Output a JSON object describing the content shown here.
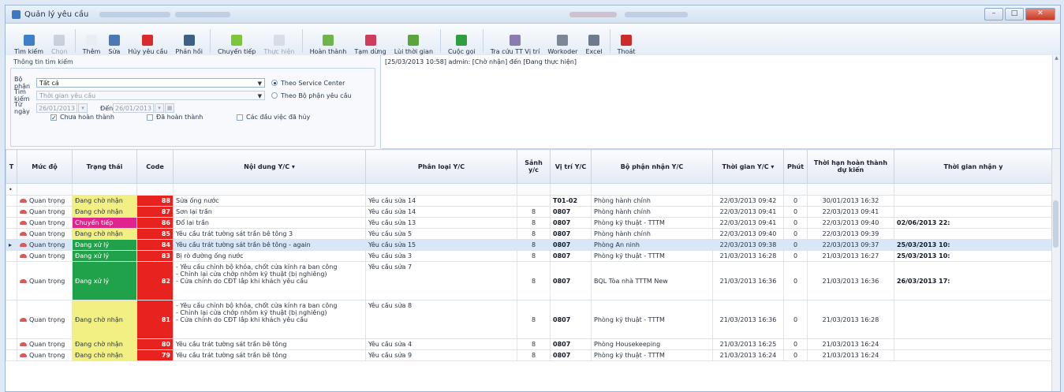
{
  "window": {
    "title": "Quản lý yêu cầu"
  },
  "colors": {
    "accent": "#3b78c4",
    "code": "#e8221e",
    "chu_nhan": "#f3f083",
    "chuyen_tiep": "#e0248e",
    "dang_xu_ly": "#1fa24a"
  },
  "toolbar": [
    {
      "label": "Tìm kiếm",
      "icon": "search-icon",
      "color": "#3d7fc9",
      "disabled": false
    },
    {
      "label": "Chọn",
      "icon": "check-icon",
      "color": "#9aa9bb",
      "disabled": true
    },
    {
      "label": "Thêm",
      "icon": "add-icon",
      "color": "#e9eef5",
      "disabled": false
    },
    {
      "label": "Sửa",
      "icon": "edit-icon",
      "color": "#4c78b6",
      "disabled": false
    },
    {
      "label": "Hủy yêu cầu",
      "icon": "cancel-icon",
      "color": "#d92b2b",
      "disabled": false
    },
    {
      "label": "Phản hồi",
      "icon": "reply-icon",
      "color": "#3e5f88",
      "disabled": false
    },
    {
      "label": "Chuyển tiếp",
      "icon": "forward-icon",
      "color": "#7cc63a",
      "disabled": false
    },
    {
      "label": "Thực hiện",
      "icon": "execute-icon",
      "color": "#b9c3d0",
      "disabled": true
    },
    {
      "label": "Hoàn thành",
      "icon": "complete-icon",
      "color": "#6fb34b",
      "disabled": false
    },
    {
      "label": "Tạm dừng",
      "icon": "pause-icon",
      "color": "#d13b5e",
      "disabled": false
    },
    {
      "label": "Lùi thời gian",
      "icon": "back-time-icon",
      "color": "#5ca53c",
      "disabled": false
    },
    {
      "label": "Cuộc gọi",
      "icon": "call-icon",
      "color": "#2f9e3f",
      "disabled": false
    },
    {
      "label": "Tra cứu TT Vị trí",
      "icon": "location-lookup-icon",
      "color": "#8a7cb0",
      "disabled": false
    },
    {
      "label": "Workoder",
      "icon": "workorder-icon",
      "color": "#7d8797",
      "disabled": false
    },
    {
      "label": "Excel",
      "icon": "excel-icon",
      "color": "#6e7b8c",
      "disabled": false
    },
    {
      "label": "Thoát",
      "icon": "exit-icon",
      "color": "#cf2a2a",
      "disabled": false
    }
  ],
  "filters": {
    "group_title": "Thông tin tìm kiếm",
    "bo_phan_label": "Bộ phận",
    "bo_phan_value": "Tất cả",
    "tim_kiem_label": "Tìm kiếm",
    "tim_kiem_value": "Thời gian yêu cầu",
    "tu_ngay_label": "Từ ngày",
    "tu_ngay_value": "26/01/2013",
    "den_label": "Đến",
    "den_value": "26/01/2013",
    "radio_service": "Theo Service Center",
    "radio_bophan": "Theo Bộ phận yêu cầu",
    "cb_chua": "Chưa hoàn thành",
    "cb_da": "Đã hoàn thành",
    "cb_huy": "Các đầu việc đã hủy"
  },
  "history": {
    "text": "[25/03/2013 10:58] admin: [Chờ nhận] đến [Đang thực hiện]"
  },
  "grid": {
    "columns": [
      "T",
      "Mức độ",
      "Trạng thái",
      "Code",
      "Nội dung Y/C",
      "Phân loại Y/C",
      "Sảnh y/c",
      "Vị trí Y/C",
      "Bộ phận nhận Y/C",
      "Thời gian Y/C",
      "Phút",
      "Thời hạn hoàn thành dự kiến",
      "Thời gian nhận y"
    ],
    "rows": [
      {
        "muc_do": "Quan trọng",
        "trang_thai": "Đang chờ nhận",
        "st": "chu_nhan",
        "code": "88",
        "noi_dung": "Sửa ống nước",
        "phan_loai": "Yêu cầu sửa 14",
        "sanh": "",
        "vi_tri": "T01-02",
        "bo_phan": "Phòng hành chính",
        "thoi_gian": "22/03/2013 09:42",
        "phut": "0",
        "thoi_han": "30/01/2013 16:32",
        "nhan": ""
      },
      {
        "muc_do": "Quan trọng",
        "trang_thai": "Đang chờ nhận",
        "st": "chu_nhan",
        "code": "87",
        "noi_dung": "Sơn lại trần",
        "phan_loai": "Yêu cầu sửa 14",
        "sanh": "8",
        "vi_tri": "0807",
        "bo_phan": "Phòng hành chính",
        "thoi_gian": "22/03/2013 09:41",
        "phut": "0",
        "thoi_han": "22/03/2013 09:41",
        "nhan": ""
      },
      {
        "muc_do": "Quan trọng",
        "trang_thai": "Chuyển tiếp",
        "st": "chuyen_tiep",
        "code": "86",
        "noi_dung": "Đổ lại trần",
        "phan_loai": "Yêu cầu sửa 13",
        "sanh": "8",
        "vi_tri": "0807",
        "bo_phan": "Phòng kỹ thuật - TTTM",
        "thoi_gian": "22/03/2013 09:41",
        "phut": "0",
        "thoi_han": "22/03/2013 09:40",
        "nhan": "02/06/2013 22:"
      },
      {
        "muc_do": "Quan trọng",
        "trang_thai": "Đang chờ nhận",
        "st": "chu_nhan",
        "code": "85",
        "noi_dung": "Yêu cầu trát tường sát trần bê tông 3",
        "phan_loai": "Yêu cầu sửa 5",
        "sanh": "8",
        "vi_tri": "0807",
        "bo_phan": "Phòng hành chính",
        "thoi_gian": "22/03/2013 09:40",
        "phut": "0",
        "thoi_han": "22/03/2013 09:39",
        "nhan": ""
      },
      {
        "muc_do": "Quan trọng",
        "trang_thai": "Đang xử lý",
        "st": "dang_xu_ly",
        "code": "84",
        "noi_dung": "Yêu cầu trát tường sát trần bê tông - again",
        "phan_loai": "Yêu cầu sửa 15",
        "sanh": "8",
        "vi_tri": "0807",
        "bo_phan": "Phòng An ninh",
        "thoi_gian": "22/03/2013 09:38",
        "phut": "0",
        "thoi_han": "22/03/2013 09:37",
        "nhan": "25/03/2013 10:"
      },
      {
        "muc_do": "Quan trọng",
        "trang_thai": "Đang xử lý",
        "st": "dang_xu_ly",
        "code": "83",
        "noi_dung": "Bị rò đường ống nước",
        "phan_loai": "Yêu cầu sửa 3",
        "sanh": "8",
        "vi_tri": "0807",
        "bo_phan": "Phòng kỹ thuật - TTTM",
        "thoi_gian": "21/03/2013 16:28",
        "phut": "0",
        "thoi_han": "21/03/2013 16:27",
        "nhan": "25/03/2013 10:"
      },
      {
        "muc_do": "Quan trọng",
        "trang_thai": "Đang xử lý",
        "st": "dang_xu_ly",
        "code": "82",
        "noi_dung": "- Yêu cầu chỉnh bộ khóa, chốt cửa kính ra ban công\n- Chỉnh lại cửa chớp nhôm kỹ thuật (bị nghiêng)\n- Cửa chính do CĐT lắp khi khách yêu cầu",
        "phan_loai": "Yêu cầu sửa 7",
        "sanh": "8",
        "vi_tri": "0807",
        "bo_phan": "BQL Tòa nhà TTTM New",
        "thoi_gian": "21/03/2013 16:36",
        "phut": "0",
        "thoi_han": "21/03/2013 16:36",
        "nhan": "26/03/2013 17:",
        "tall": true
      },
      {
        "muc_do": "Quan trọng",
        "trang_thai": "Đang chờ nhận",
        "st": "chu_nhan",
        "code": "81",
        "noi_dung": "- Yêu cầu chỉnh bộ khóa, chốt cửa kính ra ban công\n- Chỉnh lại cửa chớp nhôm kỹ thuật (bị nghiêng)\n- Cửa chính do CĐT lắp khi khách yêu cầu",
        "phan_loai": "Yêu cầu sửa 8",
        "sanh": "8",
        "vi_tri": "0807",
        "bo_phan": "Phòng kỹ thuật - TTTM",
        "thoi_gian": "21/03/2013 16:36",
        "phut": "0",
        "thoi_han": "21/03/2013 16:28",
        "nhan": "",
        "tall": true
      },
      {
        "muc_do": "Quan trọng",
        "trang_thai": "Đang chờ nhận",
        "st": "chu_nhan",
        "code": "80",
        "noi_dung": "Yêu cầu trát tường sát trần bê tông",
        "phan_loai": "Yêu cầu sửa 4",
        "sanh": "8",
        "vi_tri": "0807",
        "bo_phan": "Phòng Housekeeping",
        "thoi_gian": "21/03/2013 16:25",
        "phut": "0",
        "thoi_han": "21/03/2013 16:24",
        "nhan": ""
      },
      {
        "muc_do": "Quan trọng",
        "trang_thai": "Đang chờ nhận",
        "st": "chu_nhan",
        "code": "79",
        "noi_dung": "Yêu cầu trát tường sát trần bê tông",
        "phan_loai": "Yêu cầu sửa 9",
        "sanh": "8",
        "vi_tri": "0807",
        "bo_phan": "Phòng kỹ thuật - TTTM",
        "thoi_gian": "21/03/2013 16:24",
        "phut": "0",
        "thoi_han": "21/03/2013 16:24",
        "nhan": ""
      }
    ],
    "selected_index": 4
  }
}
